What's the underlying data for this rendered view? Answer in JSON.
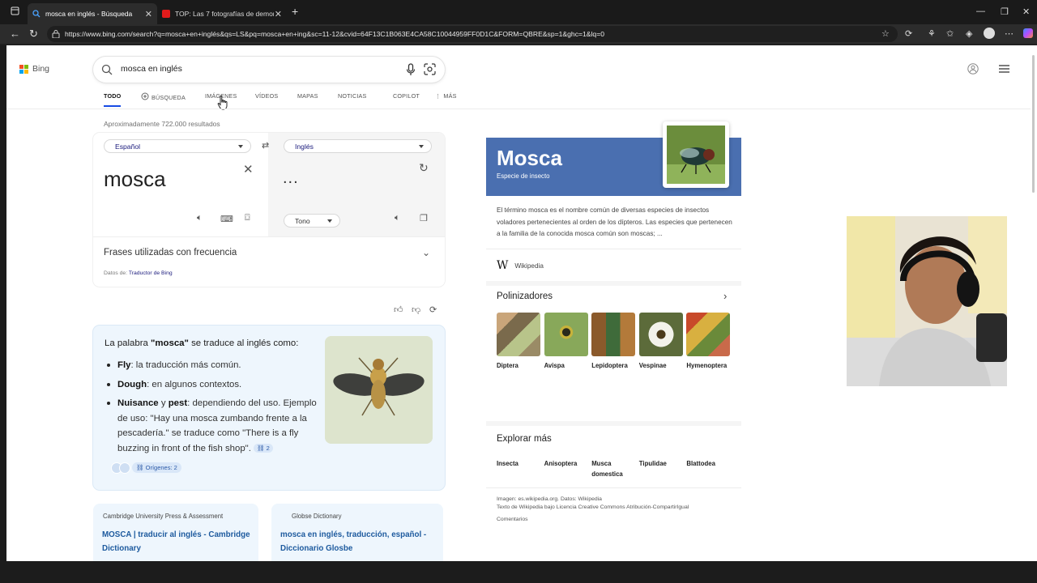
{
  "browser": {
    "tabs": [
      {
        "title": "mosca en inglés - Búsqueda"
      },
      {
        "title": "TOP: Las 7 fotografías de demonio"
      }
    ],
    "url": "https://www.bing.com/search?q=mosca+en+inglés&qs=LS&pq=mosca+en+ing&sc=11-12&cvid=64F13C1B063E4CA58C10044959FF0D1C&FORM=QBRE&sp=1&ghc=1&lq=0"
  },
  "bing": {
    "logo": "Bing",
    "query": "mosca en inglés",
    "tabs": [
      "TODO",
      "BÚSQUEDA",
      "IMÁGENES",
      "VÍDEOS",
      "MAPAS",
      "NOTICIAS",
      "COPILOT",
      "MÁS"
    ],
    "result_count": "Aproximadamente 722.000 resultados"
  },
  "translator": {
    "source_lang": "Español",
    "target_lang": "Inglés",
    "source_text": "mosca",
    "target_text": "...",
    "tone_label": "Tono",
    "phrases_label": "Frases utilizadas con frecuencia",
    "data_label": "Datos de:",
    "data_source": "Traductor de Bing"
  },
  "answer": {
    "intro_pre": "La palabra ",
    "intro_word": "\"mosca\"",
    "intro_post": " se traduce al inglés como:",
    "items": [
      {
        "term": "Fly",
        "text": ": la traducción más común."
      },
      {
        "term": "Dough",
        "text": ": en algunos contextos."
      },
      {
        "term": "Nuisance",
        "mid": " y ",
        "term2": "pest",
        "text": ": dependiendo del uso. Ejemplo de uso: \"Hay una mosca zumbando frente a la pescadería.\" se traduce como \"There is a fly buzzing in front of the fish shop\". "
      }
    ],
    "cite_count": "2",
    "origins_label": "Orígenes: 2"
  },
  "results": [
    {
      "source": "Cambridge University Press & Assessment",
      "title": "MOSCA | traducir al inglés - Cambridge Dictionary"
    },
    {
      "source": "Globse Dictionary",
      "title": "mosca en inglés, traducción, español - Diccionario Glosbe"
    }
  ],
  "knowledge_panel": {
    "title": "Mosca",
    "subtitle": "Especie de insecto",
    "description": "El término mosca es el nombre común de diversas especies de insectos voladores pertenecientes al orden de los dípteros. Las especies que pertenecen a la familia de la conocida mosca común son moscas; ...",
    "wiki_label": "Wikipedia",
    "pollinators_title": "Polinizadores",
    "pollinators": [
      "Diptera",
      "Avispa",
      "Lepidoptera",
      "Vespinae",
      "Hymenoptera"
    ],
    "explore_title": "Explorar más",
    "explore": [
      "Insecta",
      "Anisoptera",
      "Musca domestica",
      "Tipulidae",
      "Blattodea"
    ],
    "credits_line1": "Imagen: es.wikipedia.org. Datos: Wikipedia",
    "credits_line2": "Texto de Wikipedia bajo Licencia Creative Commons Atribución-CompartirIgual",
    "comments": "Comentarios"
  },
  "colors": {
    "accent": "#174ae4",
    "kp_header": "#4a6fb0",
    "answer_bg": "#eef6fd"
  }
}
